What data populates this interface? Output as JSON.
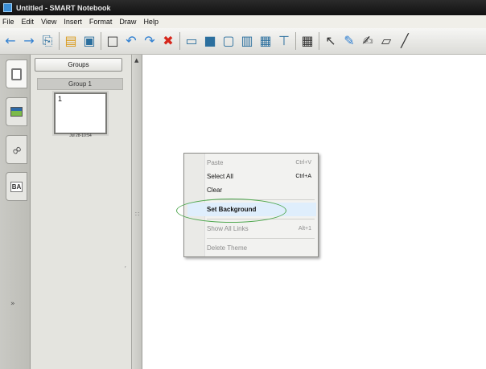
{
  "window": {
    "title": "Untitled - SMART Notebook"
  },
  "menu": {
    "items": [
      "File",
      "Edit",
      "View",
      "Insert",
      "Format",
      "Draw",
      "Help"
    ]
  },
  "toolbar": {
    "icons": [
      "back-arrow-icon",
      "forward-arrow-icon",
      "page-add-icon",
      "open-folder-icon",
      "save-icon",
      "paste-icon",
      "undo-icon",
      "redo-icon",
      "delete-icon",
      "screen-shade-icon",
      "show-projector-icon",
      "full-screen-icon",
      "dual-page-icon",
      "capture-icon",
      "document-camera-icon",
      "table-icon",
      "select-arrow-icon",
      "pen-icon",
      "creative-pen-icon",
      "eraser-icon",
      "line-icon"
    ]
  },
  "sorter": {
    "groups_button": "Groups",
    "group_label": "Group 1",
    "thumbnail_number": "1",
    "thumbnail_date": "Jul 28-10:54"
  },
  "sidetabs": [
    "page-sorter-tab",
    "gallery-tab",
    "attachments-tab",
    "properties-tab"
  ],
  "context_menu": {
    "items": [
      {
        "label": "Paste",
        "shortcut": "Ctrl+V",
        "enabled": false
      },
      {
        "label": "Select All",
        "shortcut": "Ctrl+A",
        "enabled": true
      },
      {
        "label": "Clear",
        "shortcut": "",
        "enabled": true
      },
      {
        "label": "Set Background",
        "shortcut": "",
        "enabled": true,
        "highlighted": true
      },
      {
        "label": "Show All Links",
        "shortcut": "Alt+1",
        "enabled": false
      },
      {
        "label": "Delete Theme",
        "shortcut": "",
        "enabled": false
      }
    ]
  },
  "colors": {
    "highlight_ellipse": "#4fa74f",
    "menu_hover": "#dfeefc"
  }
}
